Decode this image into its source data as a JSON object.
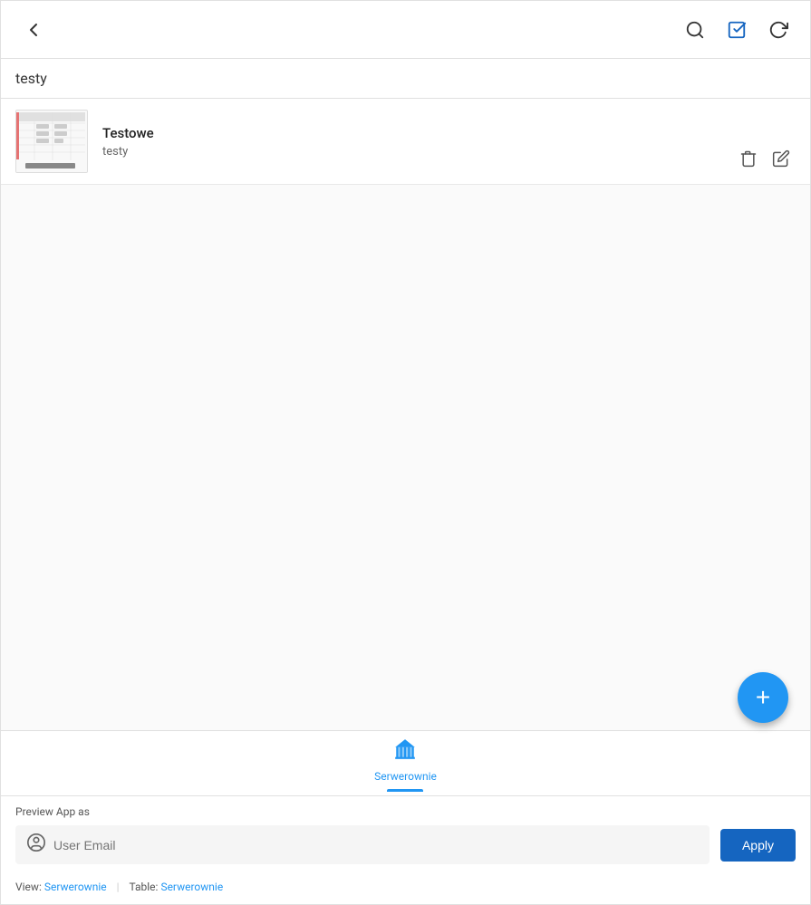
{
  "header": {
    "back_label": "←",
    "search_icon": "search-icon",
    "check_icon": "check-square-icon",
    "refresh_icon": "refresh-icon"
  },
  "page": {
    "title": "testy"
  },
  "list": {
    "items": [
      {
        "id": "item-1",
        "title": "Testowe",
        "subtitle": "testy"
      }
    ]
  },
  "fab": {
    "label": "+"
  },
  "bottom_nav": {
    "items": [
      {
        "label": "Serwerownie",
        "icon": "building-icon",
        "active": true
      }
    ]
  },
  "preview": {
    "label": "Preview App as",
    "input_placeholder": "User Email",
    "apply_label": "Apply"
  },
  "footer": {
    "view_label": "View:",
    "view_link": "Serwerownie",
    "table_label": "Table:",
    "table_link": "Serwerownie",
    "separator": "|"
  }
}
